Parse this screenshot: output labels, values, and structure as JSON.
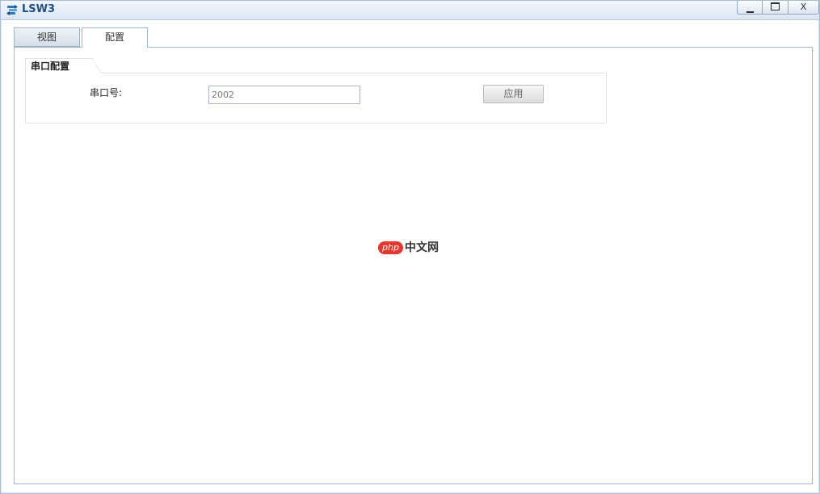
{
  "window": {
    "title": "LSW3",
    "icon": "switch-app-icon",
    "controls": {
      "minimize": "minimize-icon",
      "maximize": "maximize-icon",
      "close_label": "X"
    }
  },
  "tabs": [
    {
      "label": "视图",
      "active": false
    },
    {
      "label": "配置",
      "active": true
    }
  ],
  "serial_config": {
    "group_title": "串口配置",
    "port_label": "串口号:",
    "port_value": "2002",
    "apply_label": "应用"
  },
  "watermark": {
    "badge": "php",
    "text": "中文网"
  },
  "colors": {
    "title_text": "#1c4f8c",
    "titlebar_bg": "#dbe6f3",
    "watermark_badge": "#e8362c"
  }
}
